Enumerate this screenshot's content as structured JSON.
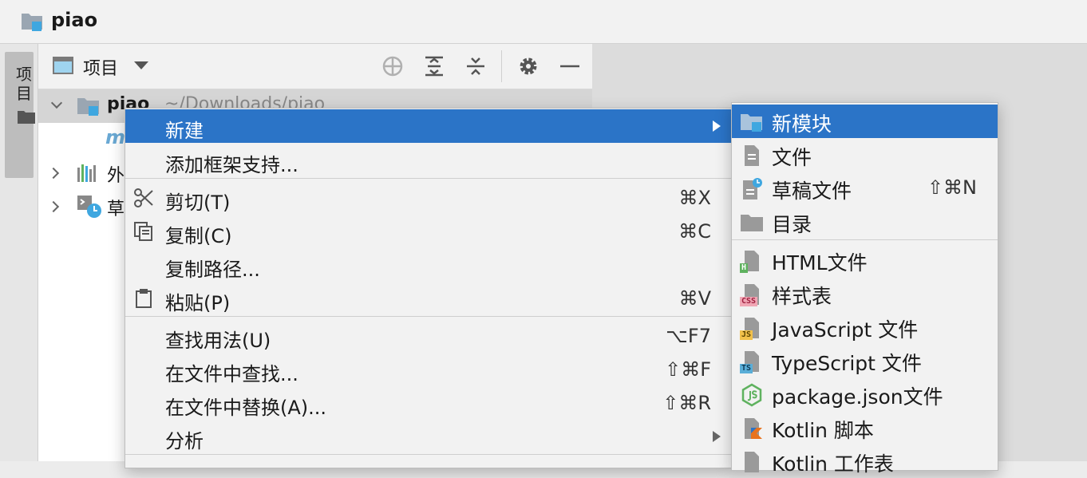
{
  "window": {
    "title": "piao"
  },
  "left_strip": {
    "tab_label": "项目"
  },
  "project_panel": {
    "view_label": "项目",
    "tree": [
      {
        "name": "piao",
        "path": "~/Downloads/piao"
      },
      {
        "name": "m"
      },
      {
        "name": "外"
      },
      {
        "name": "草"
      }
    ]
  },
  "context_menu": {
    "items": [
      {
        "label": "新建",
        "shortcut": ""
      },
      {
        "label": "添加框架支持...",
        "shortcut": ""
      },
      {
        "label": "剪切(T)",
        "shortcut": "⌘X"
      },
      {
        "label": "复制(C)",
        "shortcut": "⌘C"
      },
      {
        "label": "复制路径...",
        "shortcut": ""
      },
      {
        "label": "粘贴(P)",
        "shortcut": "⌘V"
      },
      {
        "label": "查找用法(U)",
        "shortcut": "⌥F7"
      },
      {
        "label": "在文件中查找...",
        "shortcut": "⇧⌘F"
      },
      {
        "label": "在文件中替换(A)...",
        "shortcut": "⇧⌘R"
      },
      {
        "label": "分析",
        "shortcut": ""
      }
    ]
  },
  "submenu": {
    "items": [
      {
        "label": "新模块",
        "shortcut": ""
      },
      {
        "label": "文件",
        "shortcut": ""
      },
      {
        "label": "草稿文件",
        "shortcut": "⇧⌘N"
      },
      {
        "label": "目录",
        "shortcut": ""
      },
      {
        "label": "HTML文件",
        "shortcut": "",
        "badge": "H"
      },
      {
        "label": "样式表",
        "shortcut": "",
        "badge": "CSS"
      },
      {
        "label": "JavaScript 文件",
        "shortcut": "",
        "badge": "JS"
      },
      {
        "label": "TypeScript 文件",
        "shortcut": "",
        "badge": "TS"
      },
      {
        "label": "package.json文件",
        "shortcut": ""
      },
      {
        "label": "Kotlin 脚本",
        "shortcut": ""
      },
      {
        "label": "Kotlin 工作表",
        "shortcut": ""
      }
    ]
  },
  "colors": {
    "highlight": "#2b74c7",
    "menu_bg": "#f2f2f2",
    "html_badge": "#5fb25f",
    "css_badge": "#f0a6b4",
    "js_badge": "#f2c14b",
    "ts_badge": "#5aaed8"
  }
}
